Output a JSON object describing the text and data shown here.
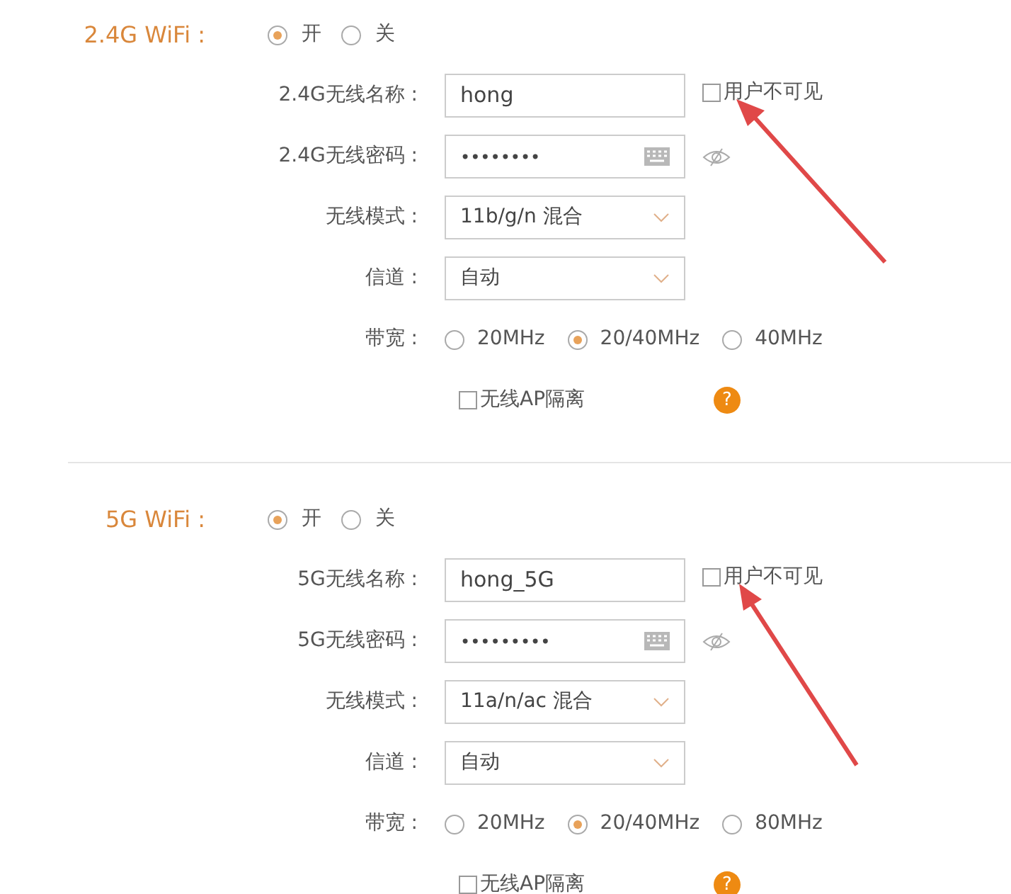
{
  "sections": [
    {
      "title": "2.4G WiFi :",
      "power": [
        {
          "label": "开",
          "selected": true
        },
        {
          "label": "关",
          "selected": false
        }
      ],
      "fields": [
        {
          "kind": "text",
          "label": "2.4G无线名称 :",
          "value": "hong",
          "hide_option": {
            "label": "用户不可见",
            "checked": false
          }
        },
        {
          "kind": "password",
          "label": "2.4G无线密码 :",
          "value": "••••••••"
        },
        {
          "kind": "select",
          "label": "无线模式 :",
          "value": "11b/g/n 混合"
        },
        {
          "kind": "select",
          "label": "信道 :",
          "value": "自动"
        },
        {
          "kind": "radio",
          "label": "带宽 :",
          "options": [
            {
              "label": "20MHz",
              "selected": false
            },
            {
              "label": "20/40MHz",
              "selected": true
            },
            {
              "label": "40MHz",
              "selected": false
            }
          ]
        },
        {
          "kind": "checkbox",
          "label": "无线AP隔离",
          "checked": false,
          "help": "?"
        }
      ]
    },
    {
      "title": "5G WiFi :",
      "power": [
        {
          "label": "开",
          "selected": true
        },
        {
          "label": "关",
          "selected": false
        }
      ],
      "fields": [
        {
          "kind": "text",
          "label": "5G无线名称 :",
          "value": "hong_5G",
          "hide_option": {
            "label": "用户不可见",
            "checked": false
          }
        },
        {
          "kind": "password",
          "label": "5G无线密码 :",
          "value": "•••••••••"
        },
        {
          "kind": "select",
          "label": "无线模式 :",
          "value": "11a/n/ac 混合"
        },
        {
          "kind": "select",
          "label": "信道 :",
          "value": "自动"
        },
        {
          "kind": "radio",
          "label": "带宽 :",
          "options": [
            {
              "label": "20MHz",
              "selected": false
            },
            {
              "label": "20/40MHz",
              "selected": true
            },
            {
              "label": "80MHz",
              "selected": false
            }
          ]
        },
        {
          "kind": "checkbox",
          "label": "无线AP隔离",
          "checked": false,
          "help": "?"
        }
      ]
    }
  ]
}
